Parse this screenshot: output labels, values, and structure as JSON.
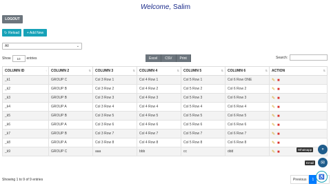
{
  "header": {
    "welcome": "Welcome,",
    "user": "Salim"
  },
  "buttons": {
    "logout": "LOGOUT",
    "reload": "Reload",
    "add_new": "+ Add New"
  },
  "filter": {
    "selected": "All"
  },
  "length": {
    "prefix": "Show",
    "value": "10",
    "suffix": "entries"
  },
  "export": {
    "excel": "Excel",
    "csv": "CSV",
    "print": "Print"
  },
  "search": {
    "label": "Search:"
  },
  "table": {
    "columns": [
      "COLUMN ID",
      "COLUMN 2",
      "COLUMN 3",
      "COLUMN 4",
      "COLUMN 5",
      "COLUMN 6",
      "ACTION"
    ],
    "rows": [
      [
        "_k1",
        "GROUP C",
        "Col 3 Row 1",
        "Col 4 Row 1",
        "Col 5 Row 1",
        "Col 6 Row ONE"
      ],
      [
        "_k2",
        "GROUP B",
        "Col 3 Row 2",
        "Col 4 Row 2",
        "Col 5 Row 2",
        "Col 6 Row 2"
      ],
      [
        "_k3",
        "GROUP B",
        "Col 3 Row 3",
        "Col 4 Row 3",
        "Col 5 Row 3",
        "Col 6 Row 3"
      ],
      [
        "_k4",
        "GROUP A",
        "Col 3 Row 4",
        "Col 4 Row 4",
        "Col 5 Row 4",
        "Col 6 Row 4"
      ],
      [
        "_k5",
        "GROUP B",
        "Col 3 Row 5",
        "Col 4 Row 5",
        "Col 5 Row 5",
        "Col 6 Row 5"
      ],
      [
        "_k6",
        "GROUP A",
        "Col 3 Row 6",
        "Col 4 Row 6",
        "Col 5 Row 6",
        "Col 6 Row 6"
      ],
      [
        "_k7",
        "GROUP B",
        "Col 3 Row 7",
        "Col 4 Row 7",
        "Col 5 Row 7",
        "Col 6 Row 7"
      ],
      [
        "_k8",
        "GROUP A",
        "Col 3 Row 8",
        "Col 4 Row 8",
        "Col 5 Row 8",
        "Col 6 Row 8"
      ],
      [
        "_k9",
        "GROUP C",
        "aaa",
        "bbb",
        "cc",
        "ddd"
      ]
    ]
  },
  "info": "Showing 1 to 9 of 9 entries",
  "pagination": {
    "previous": "Previous",
    "current": "1",
    "next": "Next"
  },
  "floating": {
    "whatsapp": "Whatsapp",
    "email": "Email"
  }
}
